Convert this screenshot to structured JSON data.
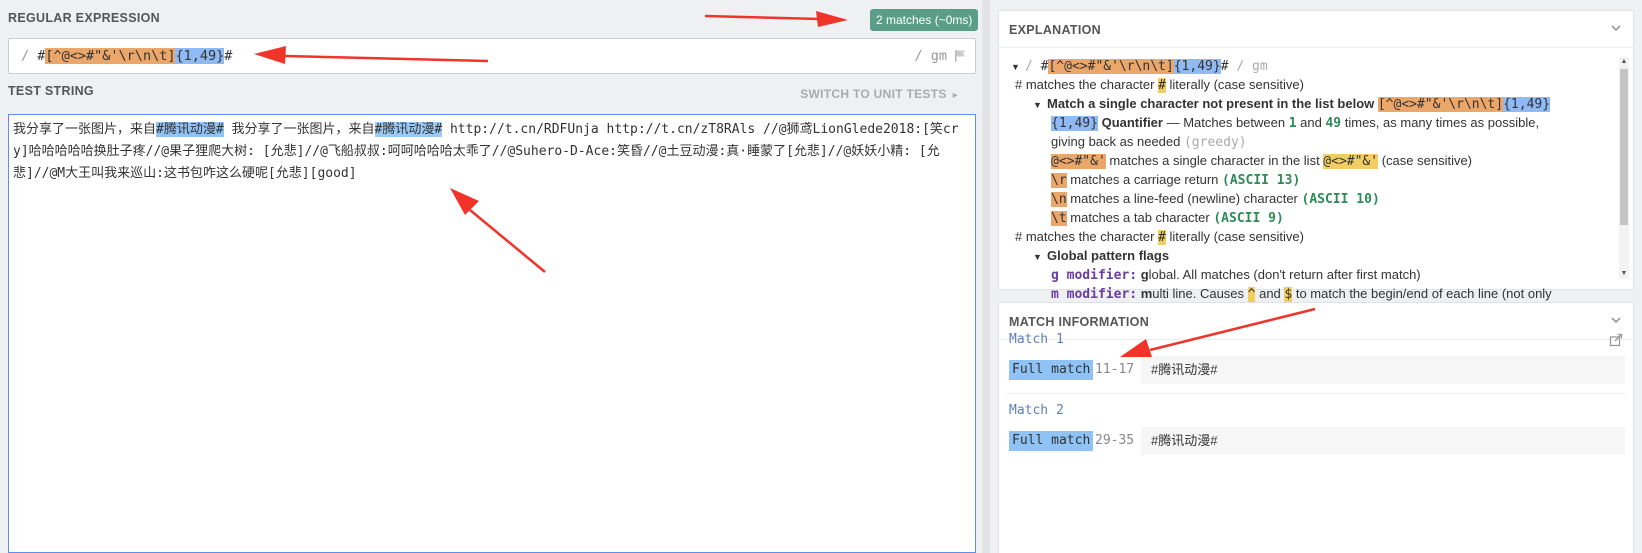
{
  "left": {
    "regex_title": "REGULAR EXPRESSION",
    "match_badge": "2 matches (~0ms)",
    "regex": {
      "open_delim": "/ ",
      "hash1": "#",
      "set": "[^@<>#\"&'\\r\\n\\t]",
      "quant": "{1,49}",
      "hash2": "#",
      "flags": "/ gm"
    },
    "test_title": "TEST STRING",
    "switch_label": "SWITCH TO UNIT TESTS",
    "test_string": {
      "seg1": "我分享了一张图片，来自",
      "match1": "#腾讯动漫#",
      "seg2": " 我分享了一张图片，来自",
      "match2": "#腾讯动漫#",
      "seg3": " http://t.cn/RDFUnja http://t.cn/zT8RAls //@狮鸢LionGlede2018:[笑cry]哈哈哈哈哈换肚子疼//@果子狸爬大树: [允悲]//@飞船叔叔:呵呵哈哈哈太乖了//@Suhero-D-Ace:笑昏//@土豆动漫:真·睡蒙了[允悲]//@妖妖小精: [允悲]//@M大王叫我来巡山:这书包咋这么硬呢[允悲][good]"
    }
  },
  "explanation": {
    "title": "EXPLANATION",
    "r0": {
      "open": "/ ",
      "hash": "#",
      "set": "[^@<>#\"&'\\r\\n\\t]",
      "quant": "{1,49}",
      "close_hash": "#",
      "flags": " / gm"
    },
    "r1": {
      "pre": "# matches the character ",
      "tok": "#",
      "post": " literally (case sensitive)"
    },
    "r2": {
      "text": "Match a single character not present in the list below ",
      "set": "[^@<>#\"&'\\r\\n\\t]",
      "quant": "{1,49}"
    },
    "r3": {
      "quant": "{1,49}",
      "label": " Quantifier",
      "mid": " — Matches between ",
      "n1": "1",
      "and": " and ",
      "n2": "49",
      "post": " times, as many times as possible,"
    },
    "r4": {
      "pre": "giving back as needed ",
      "greedy": "(greedy)"
    },
    "r5": {
      "tok": "@<>#\"&'",
      "mid": " matches a single character in the list ",
      "tok2": "@<>#\"&'",
      "post": " (case sensitive)"
    },
    "r6": {
      "tok": "\\r",
      "mid": " matches a carriage return ",
      "code": "(ASCII 13)"
    },
    "r7": {
      "tok": "\\n",
      "mid": " matches a line-feed (newline) character ",
      "code": "(ASCII 10)"
    },
    "r8": {
      "tok": "\\t",
      "mid": " matches a tab character ",
      "code": "(ASCII 9)"
    },
    "r9": {
      "pre": "# matches the character ",
      "tok": "#",
      "post": " literally (case sensitive)"
    },
    "r10": {
      "text": "Global pattern flags"
    },
    "r11": {
      "mod": "g modifier:",
      "b": " g",
      "post": "lobal. All matches (don't return after first match)"
    },
    "r12": {
      "mod": "m modifier:",
      "b": " m",
      "mid": "ulti line. Causes ",
      "tok1": "^",
      "and": " and ",
      "tok2": "$",
      "post": " to match the begin/end of each line (not only"
    }
  },
  "match_info": {
    "title": "MATCH INFORMATION",
    "matches": [
      {
        "label": "Match 1",
        "kind": "Full match",
        "range": "11-17",
        "value": "#腾讯动漫#"
      },
      {
        "label": "Match 2",
        "kind": "Full match",
        "range": "29-35",
        "value": "#腾讯动漫#"
      }
    ]
  },
  "colors": {
    "badge": "#5a9e87",
    "char_set": "#eba66a",
    "quantifier": "#8fbaf3",
    "match_highlight": "#8fc3f5",
    "annotation_arrow": "#f0342a"
  }
}
